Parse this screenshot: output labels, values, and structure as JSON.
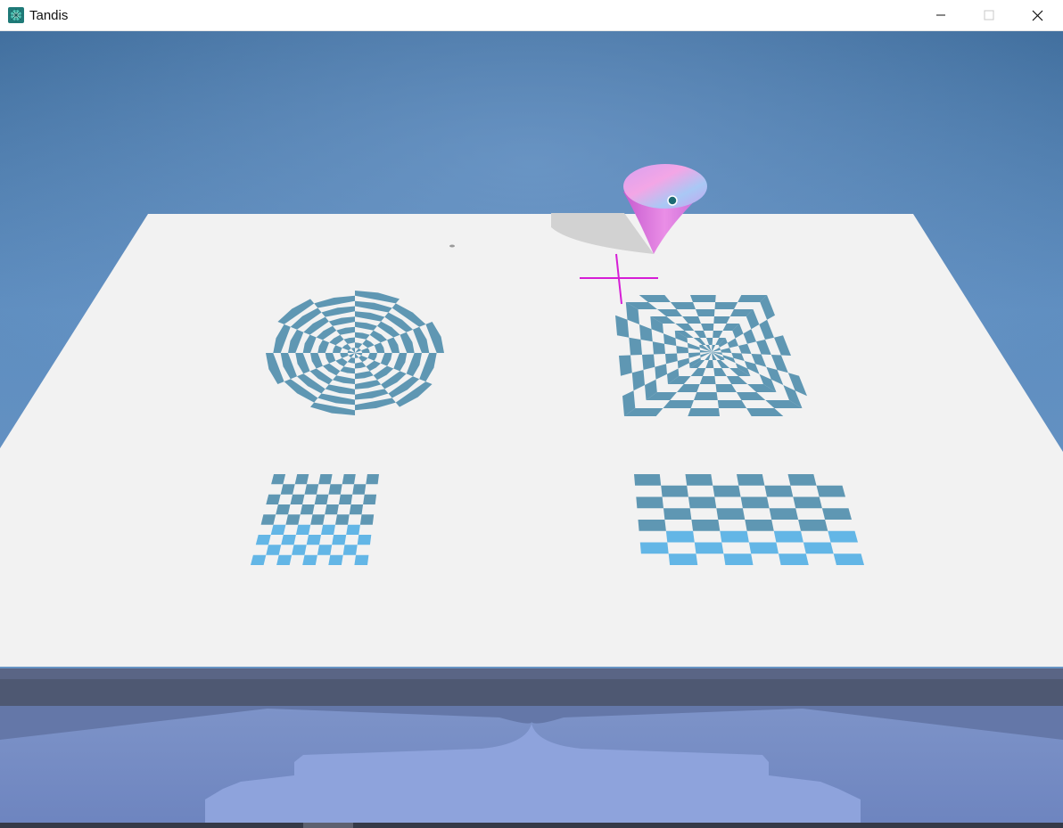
{
  "window": {
    "title": "Tandis",
    "icon": "tandis-app-icon",
    "controls": [
      "minimize-icon",
      "maximize-icon",
      "close-icon"
    ]
  },
  "scene": {
    "background_colors": {
      "sky_top": "#3f6d9c",
      "sky_mid": "#6b96c6",
      "table_top": "#f2f2f2",
      "table_edge": "#5a6580",
      "pattern": "#5f97b3",
      "pattern_light": "#63b6e6",
      "cone_body": "#e07ad8",
      "cone_top": "#b9a8f0",
      "crosshair": "#d61ed6",
      "reflection": "#8aa0d8"
    },
    "objects": [
      "circular-target-pattern",
      "square-spiral-pattern",
      "small-checkerboard",
      "large-checkerboard",
      "spinning-cone",
      "aim-crosshair"
    ]
  }
}
